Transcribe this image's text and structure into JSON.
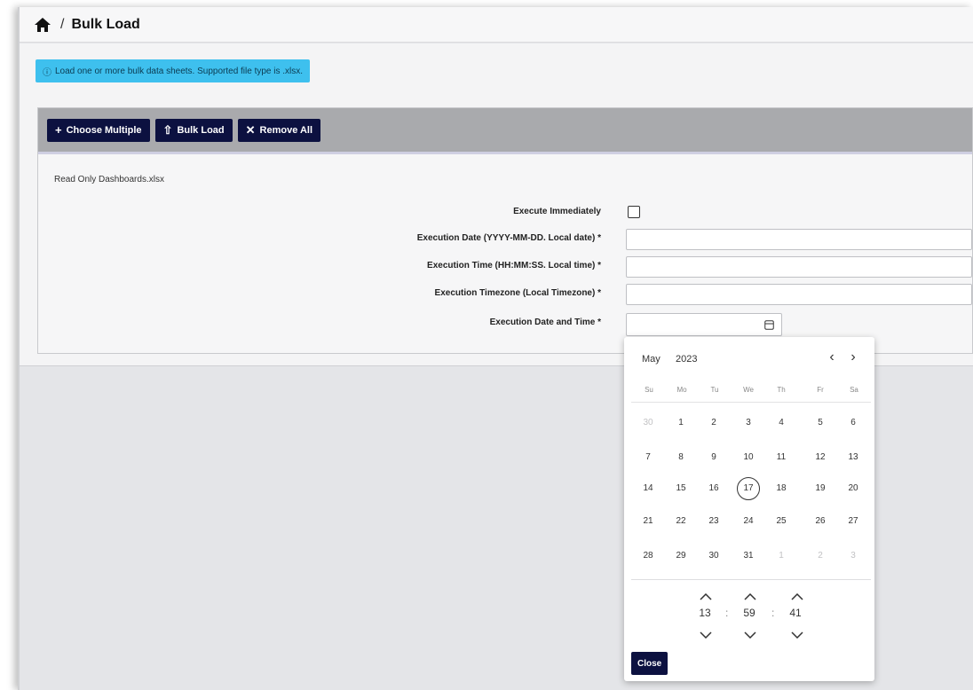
{
  "breadcrumb": {
    "separator": "/",
    "title": "Bulk Load"
  },
  "info_banner": {
    "icon": "info-icon",
    "text": "Load one or more bulk data sheets. Supported file type is .xlsx."
  },
  "toolbar": {
    "choose_icon": "+",
    "choose_label": "Choose Multiple",
    "bulk_icon": "⇧",
    "bulk_label": "Bulk Load",
    "remove_icon": "✕",
    "remove_label": "Remove All"
  },
  "file": {
    "name": "Read Only Dashboards.xlsx"
  },
  "form": {
    "execute_immediately_label": "Execute Immediately",
    "execution_date_label": "Execution Date (YYYY-MM-DD. Local date) *",
    "execution_time_label": "Execution Time (HH:MM:SS. Local time) *",
    "execution_timezone_label": "Execution Timezone (Local Timezone) *",
    "execution_datetime_label": "Execution Date and Time *"
  },
  "calendar": {
    "month": "May",
    "year": "2023",
    "prev": "‹",
    "next": "›",
    "weekdays": [
      "Su",
      "Mo",
      "Tu",
      "We",
      "Th",
      "Fr",
      "Sa"
    ],
    "weeks": [
      [
        "30",
        "1",
        "2",
        "3",
        "4",
        "5",
        "6"
      ],
      [
        "7",
        "8",
        "9",
        "10",
        "11",
        "12",
        "13"
      ],
      [
        "14",
        "15",
        "16",
        "17",
        "18",
        "19",
        "20"
      ],
      [
        "21",
        "22",
        "23",
        "24",
        "25",
        "26",
        "27"
      ],
      [
        "28",
        "29",
        "30",
        "31",
        "1",
        "2",
        "3"
      ]
    ],
    "today": "17",
    "time": {
      "hour": "13",
      "minute": "59",
      "second": "41",
      "separator": ":"
    },
    "close_label": "Close"
  },
  "colors": {
    "accent": "#0c1140",
    "info": "#3ec0ee",
    "toolbar": "#a9aaad"
  }
}
